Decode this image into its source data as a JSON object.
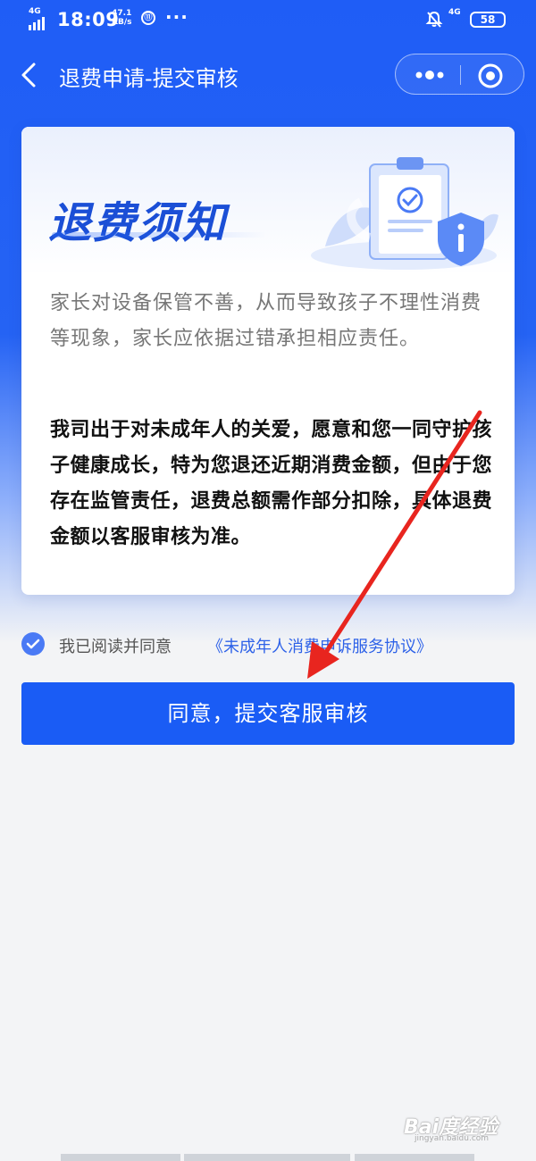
{
  "status_bar": {
    "network_left": "4G",
    "time": "18:09",
    "speed_value": "47.1",
    "speed_unit": "KB/s",
    "badge": "⑪",
    "more": "···",
    "network_right": "4G",
    "battery": "58"
  },
  "nav": {
    "title": "退费申请-提交审核"
  },
  "notice": {
    "title": "退费须知",
    "paragraph_normal": "家长对设备保管不善，从而导致孩子不理性消费等现象，家长应依据过错承担相应责任。",
    "paragraph_bold": "我司出于对未成年人的关爱，愿意和您一同守护孩子健康成长，特为您退还近期消费金额，但由于您存在监管责任，退费总额需作部分扣除，具体退费金额以客服审核为准。"
  },
  "agreement": {
    "checked": true,
    "text": "我已阅读并同意",
    "link": "《未成年人消费申诉服务协议》"
  },
  "submit": {
    "label": "同意，提交客服审核"
  },
  "watermark": {
    "main": "Bai度经验",
    "sub": "jingyan.baidu.com"
  },
  "colors": {
    "primary": "#1a5cf5",
    "header_gradient_top": "#1f5df6",
    "link": "#2e62e8",
    "annotation_arrow": "#e8251f"
  }
}
